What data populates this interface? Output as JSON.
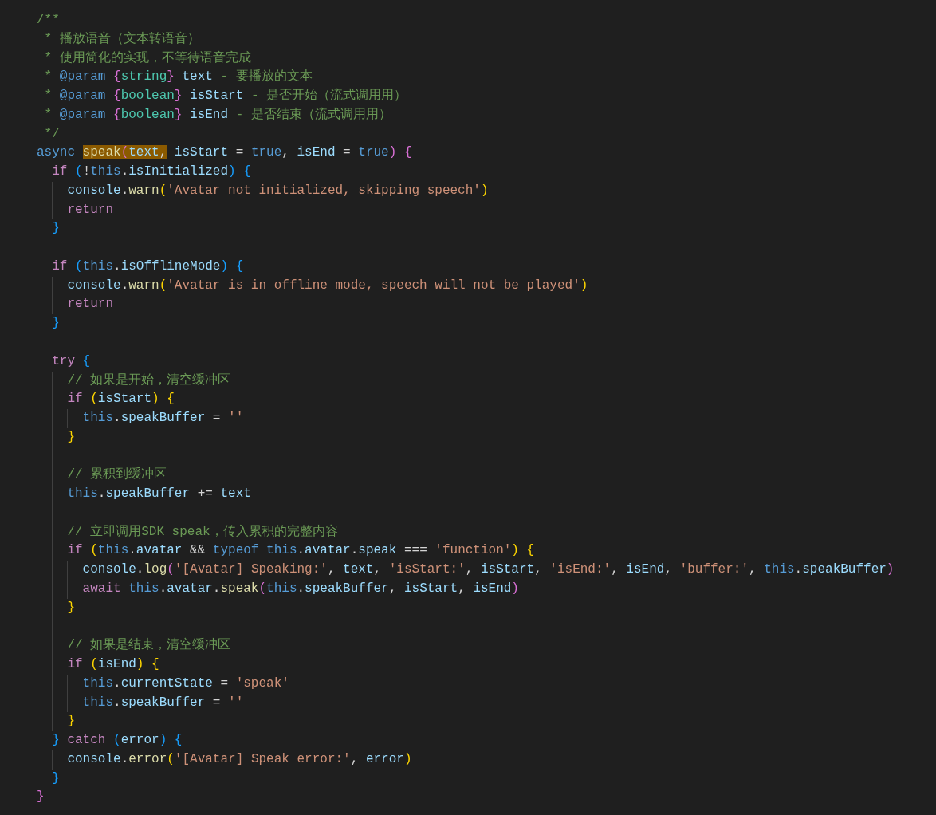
{
  "editor": {
    "lines": [
      {
        "kind": "code",
        "tokens": [
          {
            "text": "/**",
            "kind": "cm"
          }
        ]
      },
      {
        "kind": "code",
        "tokens": [
          {
            "text": " * 播放语音（文本转语音）",
            "kind": "cm"
          }
        ]
      },
      {
        "kind": "code",
        "tokens": [
          {
            "text": " * 使用简化的实现，不等待语音完成",
            "kind": "cm"
          }
        ]
      },
      {
        "kind": "code",
        "tokens": [
          {
            "text": " * ",
            "kind": "cm"
          },
          {
            "text": "@param ",
            "kind": "kw"
          },
          {
            "text": "{",
            "kind": "b2"
          },
          {
            "text": "string",
            "kind": "type"
          },
          {
            "text": "} ",
            "kind": "b2"
          },
          {
            "text": "text",
            "kind": "var"
          },
          {
            "text": " - 要播放的文本",
            "kind": "cm"
          }
        ]
      },
      {
        "kind": "code",
        "tokens": [
          {
            "text": " * ",
            "kind": "cm"
          },
          {
            "text": "@param ",
            "kind": "kw"
          },
          {
            "text": "{",
            "kind": "b2"
          },
          {
            "text": "boolean",
            "kind": "type"
          },
          {
            "text": "} ",
            "kind": "b2"
          },
          {
            "text": "isStart",
            "kind": "var"
          },
          {
            "text": " - 是否开始（流式调用用）",
            "kind": "cm"
          }
        ]
      },
      {
        "kind": "code",
        "tokens": [
          {
            "text": " * ",
            "kind": "cm"
          },
          {
            "text": "@param ",
            "kind": "kw"
          },
          {
            "text": "{",
            "kind": "b2"
          },
          {
            "text": "boolean",
            "kind": "type"
          },
          {
            "text": "} ",
            "kind": "b2"
          },
          {
            "text": "isEnd",
            "kind": "var"
          },
          {
            "text": " - 是否结束（流式调用用）",
            "kind": "cm"
          }
        ]
      },
      {
        "kind": "code",
        "tokens": [
          {
            "text": " */",
            "kind": "cm"
          }
        ]
      },
      {
        "kind": "code",
        "tokens": [
          {
            "text": "async ",
            "kind": "kw"
          },
          {
            "text": "speak",
            "kind": "fn",
            "highlighted": true
          },
          {
            "text": "(",
            "kind": "b2",
            "highlighted": true
          },
          {
            "text": "text",
            "kind": "var",
            "highlighted": true
          },
          {
            "text": ",",
            "kind": "p",
            "highlighted": true
          },
          {
            "text": " isStart",
            "kind": "var"
          },
          {
            "text": " = ",
            "kind": "p"
          },
          {
            "text": "true",
            "kind": "kw"
          },
          {
            "text": ", ",
            "kind": "p"
          },
          {
            "text": "isEnd",
            "kind": "var"
          },
          {
            "text": " = ",
            "kind": "p"
          },
          {
            "text": "true",
            "kind": "kw"
          },
          {
            "text": ") ",
            "kind": "b2"
          },
          {
            "text": "{",
            "kind": "b2"
          }
        ]
      },
      {
        "kind": "code",
        "tokens": [
          {
            "text": "  if ",
            "kind": "ctl"
          },
          {
            "text": "(",
            "kind": "b3"
          },
          {
            "text": "!",
            "kind": "p"
          },
          {
            "text": "this",
            "kind": "kw"
          },
          {
            "text": ".",
            "kind": "p"
          },
          {
            "text": "isInitialized",
            "kind": "var"
          },
          {
            "text": ") ",
            "kind": "b3"
          },
          {
            "text": "{",
            "kind": "b3"
          }
        ]
      },
      {
        "kind": "code",
        "tokens": [
          {
            "text": "    console",
            "kind": "var"
          },
          {
            "text": ".",
            "kind": "p"
          },
          {
            "text": "warn",
            "kind": "fn"
          },
          {
            "text": "(",
            "kind": "b1"
          },
          {
            "text": "'Avatar not initialized, skipping speech'",
            "kind": "str"
          },
          {
            "text": ")",
            "kind": "b1"
          }
        ]
      },
      {
        "kind": "code",
        "tokens": [
          {
            "text": "    return",
            "kind": "ctl"
          }
        ]
      },
      {
        "kind": "code",
        "tokens": [
          {
            "text": "  }",
            "kind": "b3"
          }
        ]
      },
      {
        "kind": "blank"
      },
      {
        "kind": "code",
        "tokens": [
          {
            "text": "  if ",
            "kind": "ctl"
          },
          {
            "text": "(",
            "kind": "b3"
          },
          {
            "text": "this",
            "kind": "kw"
          },
          {
            "text": ".",
            "kind": "p"
          },
          {
            "text": "isOfflineMode",
            "kind": "var"
          },
          {
            "text": ") ",
            "kind": "b3"
          },
          {
            "text": "{",
            "kind": "b3"
          }
        ]
      },
      {
        "kind": "code",
        "tokens": [
          {
            "text": "    console",
            "kind": "var"
          },
          {
            "text": ".",
            "kind": "p"
          },
          {
            "text": "warn",
            "kind": "fn"
          },
          {
            "text": "(",
            "kind": "b1"
          },
          {
            "text": "'Avatar is in offline mode, speech will not be played'",
            "kind": "str"
          },
          {
            "text": ")",
            "kind": "b1"
          }
        ]
      },
      {
        "kind": "code",
        "tokens": [
          {
            "text": "    return",
            "kind": "ctl"
          }
        ]
      },
      {
        "kind": "code",
        "tokens": [
          {
            "text": "  }",
            "kind": "b3"
          }
        ]
      },
      {
        "kind": "blank"
      },
      {
        "kind": "code",
        "tokens": [
          {
            "text": "  try ",
            "kind": "ctl"
          },
          {
            "text": "{",
            "kind": "b3"
          }
        ]
      },
      {
        "kind": "code",
        "tokens": [
          {
            "text": "    // 如果是开始，清空缓冲区",
            "kind": "cm"
          }
        ]
      },
      {
        "kind": "code",
        "tokens": [
          {
            "text": "    if ",
            "kind": "ctl"
          },
          {
            "text": "(",
            "kind": "b1"
          },
          {
            "text": "isStart",
            "kind": "var"
          },
          {
            "text": ") ",
            "kind": "b1"
          },
          {
            "text": "{",
            "kind": "b1"
          }
        ]
      },
      {
        "kind": "code",
        "tokens": [
          {
            "text": "      this",
            "kind": "kw"
          },
          {
            "text": ".",
            "kind": "p"
          },
          {
            "text": "speakBuffer",
            "kind": "var"
          },
          {
            "text": " = ",
            "kind": "p"
          },
          {
            "text": "''",
            "kind": "str"
          }
        ]
      },
      {
        "kind": "code",
        "tokens": [
          {
            "text": "    }",
            "kind": "b1"
          }
        ]
      },
      {
        "kind": "blank"
      },
      {
        "kind": "code",
        "tokens": [
          {
            "text": "    // 累积到缓冲区",
            "kind": "cm"
          }
        ]
      },
      {
        "kind": "code",
        "tokens": [
          {
            "text": "    this",
            "kind": "kw"
          },
          {
            "text": ".",
            "kind": "p"
          },
          {
            "text": "speakBuffer",
            "kind": "var"
          },
          {
            "text": " += ",
            "kind": "p"
          },
          {
            "text": "text",
            "kind": "var"
          }
        ]
      },
      {
        "kind": "blank"
      },
      {
        "kind": "code",
        "tokens": [
          {
            "text": "    // 立即调用SDK speak，传入累积的完整内容",
            "kind": "cm"
          }
        ]
      },
      {
        "kind": "code",
        "tokens": [
          {
            "text": "    if ",
            "kind": "ctl"
          },
          {
            "text": "(",
            "kind": "b1"
          },
          {
            "text": "this",
            "kind": "kw"
          },
          {
            "text": ".",
            "kind": "p"
          },
          {
            "text": "avatar",
            "kind": "var"
          },
          {
            "text": " && ",
            "kind": "p"
          },
          {
            "text": "typeof ",
            "kind": "kw"
          },
          {
            "text": "this",
            "kind": "kw"
          },
          {
            "text": ".",
            "kind": "p"
          },
          {
            "text": "avatar",
            "kind": "var"
          },
          {
            "text": ".",
            "kind": "p"
          },
          {
            "text": "speak",
            "kind": "var"
          },
          {
            "text": " === ",
            "kind": "p"
          },
          {
            "text": "'function'",
            "kind": "str"
          },
          {
            "text": ") ",
            "kind": "b1"
          },
          {
            "text": "{",
            "kind": "b1"
          }
        ]
      },
      {
        "kind": "code",
        "tokens": [
          {
            "text": "      console",
            "kind": "var"
          },
          {
            "text": ".",
            "kind": "p"
          },
          {
            "text": "log",
            "kind": "fn"
          },
          {
            "text": "(",
            "kind": "b2"
          },
          {
            "text": "'[Avatar] Speaking:'",
            "kind": "str"
          },
          {
            "text": ", ",
            "kind": "p"
          },
          {
            "text": "text",
            "kind": "var"
          },
          {
            "text": ", ",
            "kind": "p"
          },
          {
            "text": "'isStart:'",
            "kind": "str"
          },
          {
            "text": ", ",
            "kind": "p"
          },
          {
            "text": "isStart",
            "kind": "var"
          },
          {
            "text": ", ",
            "kind": "p"
          },
          {
            "text": "'isEnd:'",
            "kind": "str"
          },
          {
            "text": ", ",
            "kind": "p"
          },
          {
            "text": "isEnd",
            "kind": "var"
          },
          {
            "text": ", ",
            "kind": "p"
          },
          {
            "text": "'buffer:'",
            "kind": "str"
          },
          {
            "text": ", ",
            "kind": "p"
          },
          {
            "text": "this",
            "kind": "kw"
          },
          {
            "text": ".",
            "kind": "p"
          },
          {
            "text": "speakBuffer",
            "kind": "var"
          },
          {
            "text": ")",
            "kind": "b2"
          }
        ]
      },
      {
        "kind": "code",
        "tokens": [
          {
            "text": "      await ",
            "kind": "ctl"
          },
          {
            "text": "this",
            "kind": "kw"
          },
          {
            "text": ".",
            "kind": "p"
          },
          {
            "text": "avatar",
            "kind": "var"
          },
          {
            "text": ".",
            "kind": "p"
          },
          {
            "text": "speak",
            "kind": "fn"
          },
          {
            "text": "(",
            "kind": "b2"
          },
          {
            "text": "this",
            "kind": "kw"
          },
          {
            "text": ".",
            "kind": "p"
          },
          {
            "text": "speakBuffer",
            "kind": "var"
          },
          {
            "text": ", ",
            "kind": "p"
          },
          {
            "text": "isStart",
            "kind": "var"
          },
          {
            "text": ", ",
            "kind": "p"
          },
          {
            "text": "isEnd",
            "kind": "var"
          },
          {
            "text": ")",
            "kind": "b2"
          }
        ]
      },
      {
        "kind": "code",
        "tokens": [
          {
            "text": "    }",
            "kind": "b1"
          }
        ]
      },
      {
        "kind": "blank"
      },
      {
        "kind": "code",
        "tokens": [
          {
            "text": "    // 如果是结束，清空缓冲区",
            "kind": "cm"
          }
        ]
      },
      {
        "kind": "code",
        "tokens": [
          {
            "text": "    if ",
            "kind": "ctl"
          },
          {
            "text": "(",
            "kind": "b1"
          },
          {
            "text": "isEnd",
            "kind": "var"
          },
          {
            "text": ") ",
            "kind": "b1"
          },
          {
            "text": "{",
            "kind": "b1"
          }
        ]
      },
      {
        "kind": "code",
        "tokens": [
          {
            "text": "      this",
            "kind": "kw"
          },
          {
            "text": ".",
            "kind": "p"
          },
          {
            "text": "currentState",
            "kind": "var"
          },
          {
            "text": " = ",
            "kind": "p"
          },
          {
            "text": "'speak'",
            "kind": "str"
          }
        ]
      },
      {
        "kind": "code",
        "tokens": [
          {
            "text": "      this",
            "kind": "kw"
          },
          {
            "text": ".",
            "kind": "p"
          },
          {
            "text": "speakBuffer",
            "kind": "var"
          },
          {
            "text": " = ",
            "kind": "p"
          },
          {
            "text": "''",
            "kind": "str"
          }
        ]
      },
      {
        "kind": "code",
        "tokens": [
          {
            "text": "    }",
            "kind": "b1"
          }
        ]
      },
      {
        "kind": "code",
        "tokens": [
          {
            "text": "  } ",
            "kind": "b3"
          },
          {
            "text": "catch ",
            "kind": "ctl"
          },
          {
            "text": "(",
            "kind": "b3"
          },
          {
            "text": "error",
            "kind": "var"
          },
          {
            "text": ") ",
            "kind": "b3"
          },
          {
            "text": "{",
            "kind": "b3"
          }
        ]
      },
      {
        "kind": "code",
        "tokens": [
          {
            "text": "    console",
            "kind": "var"
          },
          {
            "text": ".",
            "kind": "p"
          },
          {
            "text": "error",
            "kind": "fn"
          },
          {
            "text": "(",
            "kind": "b1"
          },
          {
            "text": "'[Avatar] Speak error:'",
            "kind": "str"
          },
          {
            "text": ", ",
            "kind": "p"
          },
          {
            "text": "error",
            "kind": "var"
          },
          {
            "text": ")",
            "kind": "b1"
          }
        ]
      },
      {
        "kind": "code",
        "tokens": [
          {
            "text": "  }",
            "kind": "b3"
          }
        ]
      },
      {
        "kind": "code",
        "tokens": [
          {
            "text": "}",
            "kind": "b2"
          }
        ]
      }
    ]
  }
}
